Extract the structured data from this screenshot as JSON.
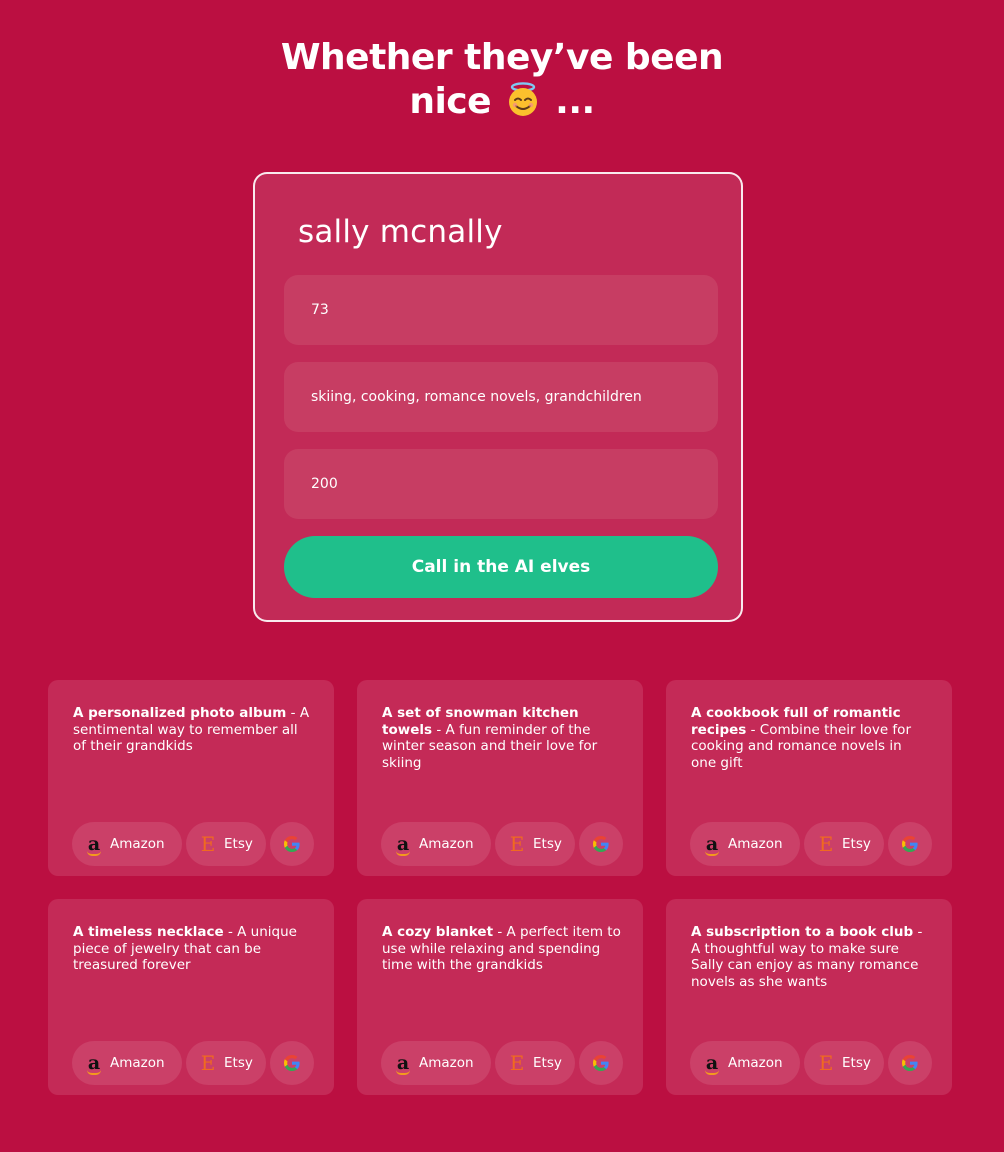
{
  "hero": {
    "line1": "Whether they’ve been",
    "line2_start": "nice",
    "line2_end": "...",
    "emoji_icon": "smiling-face-with-halo-icon"
  },
  "form": {
    "name_value": "sally mcnally",
    "age_value": "73",
    "interests_value": "skiing, cooking, romance novels, grandchildren",
    "budget_value": "200",
    "submit_label": "Call in the AI elves"
  },
  "colors": {
    "background": "#bb0f41",
    "card": "#c42a57",
    "field": "#c73d63",
    "button": "#1fbf8b"
  },
  "shops": {
    "amazon_label": "Amazon",
    "etsy_label": "Etsy",
    "amazon_icon": "amazon-icon",
    "etsy_icon": "etsy-icon",
    "google_icon": "google-icon"
  },
  "ideas": [
    {
      "title": "A personalized photo album",
      "sep": " - ",
      "desc": "A sentimental way to remember all of their grandkids"
    },
    {
      "title": "A set of snowman kitchen towels",
      "sep": " - ",
      "desc": "A fun reminder of the winter season and their love for skiing"
    },
    {
      "title": "A cookbook full of romantic recipes",
      "sep": " - ",
      "desc": "Combine their love for cooking and romance novels in one gift"
    },
    {
      "title": "A timeless necklace",
      "sep": " - ",
      "desc": "A unique piece of jewelry that can be treasured forever"
    },
    {
      "title": "A cozy blanket",
      "sep": " - ",
      "desc": "A perfect item to use while relaxing and spending time with the grandkids"
    },
    {
      "title": "A subscription to a book club",
      "sep": " - ",
      "desc": "A thoughtful way to make sure Sally can enjoy as many romance novels as she wants"
    }
  ]
}
